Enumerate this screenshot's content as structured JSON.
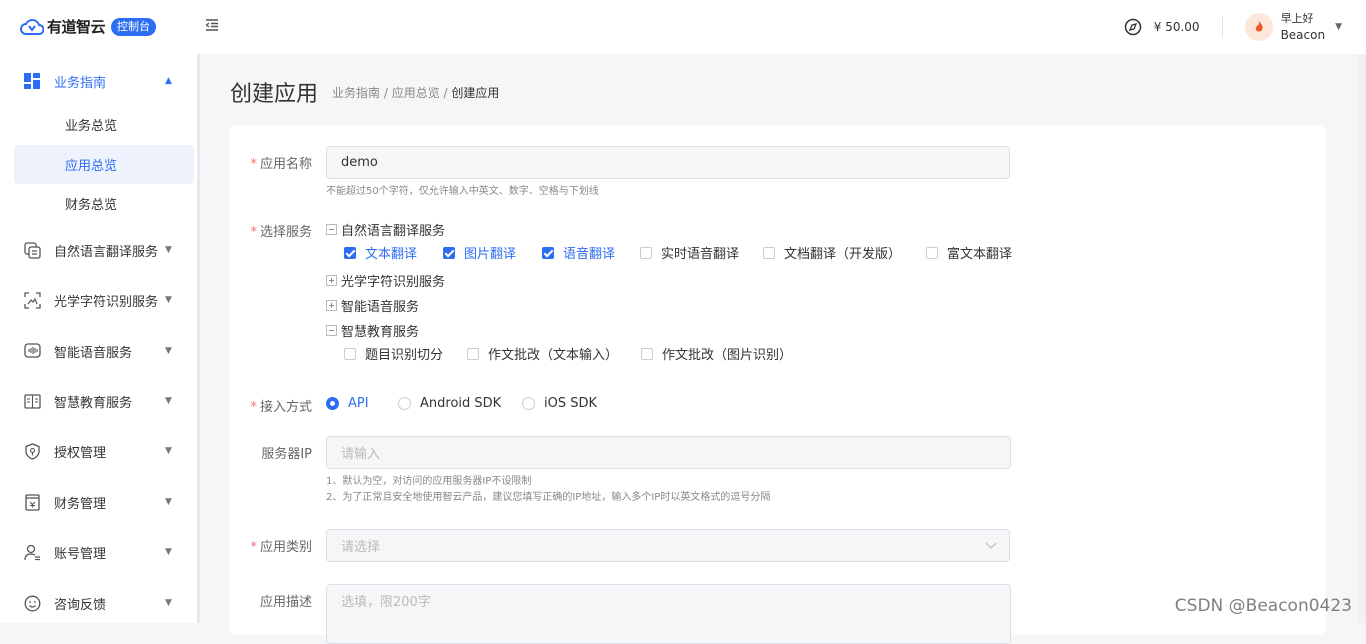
{
  "header": {
    "logo_text": "有道智云",
    "logo_badge": "控制台",
    "balance": "¥ 50.00",
    "greeting": "早上好",
    "username": "Beacon"
  },
  "sidebar": {
    "group1": {
      "label": "业务指南",
      "items": [
        "业务总览",
        "应用总览",
        "财务总览"
      ]
    },
    "menus": [
      "自然语言翻译服务",
      "光学字符识别服务",
      "智能语音服务",
      "智慧教育服务",
      "授权管理",
      "财务管理",
      "账号管理",
      "咨询反馈"
    ]
  },
  "page": {
    "title": "创建应用",
    "breadcrumb": [
      "业务指南",
      "应用总览",
      "创建应用"
    ],
    "sep": " / "
  },
  "form": {
    "name_label": "应用名称",
    "name_value": "demo",
    "name_hint": "不能超过50个字符，仅允许输入中英文、数字、空格与下划线",
    "service_label": "选择服务",
    "services": {
      "nlp": {
        "label": "自然语言翻译服务",
        "options": [
          {
            "label": "文本翻译",
            "checked": true
          },
          {
            "label": "图片翻译",
            "checked": true
          },
          {
            "label": "语音翻译",
            "checked": true
          },
          {
            "label": "实时语音翻译",
            "checked": false
          },
          {
            "label": "文档翻译（开发版）",
            "checked": false
          },
          {
            "label": "富文本翻译",
            "checked": false
          }
        ]
      },
      "ocr": {
        "label": "光学字符识别服务"
      },
      "voice": {
        "label": "智能语音服务"
      },
      "edu": {
        "label": "智慧教育服务",
        "options": [
          {
            "label": "题目识别切分",
            "checked": false
          },
          {
            "label": "作文批改（文本输入）",
            "checked": false
          },
          {
            "label": "作文批改（图片识别）",
            "checked": false
          }
        ]
      }
    },
    "access_label": "接入方式",
    "access_options": [
      {
        "label": "API",
        "selected": true
      },
      {
        "label": "Android SDK",
        "selected": false
      },
      {
        "label": "iOS SDK",
        "selected": false
      }
    ],
    "ip_label": "服务器IP",
    "ip_placeholder": "请输入",
    "ip_hint1": "1、默认为空，对访问的应用服务器IP不设限制",
    "ip_hint2": "2、为了正常且安全地使用智云产品，建议您填写正确的IP地址，输入多个IP时以英文格式的逗号分隔",
    "category_label": "应用类别",
    "category_placeholder": "请选择",
    "desc_label": "应用描述",
    "desc_placeholder": "选填，限200字"
  },
  "watermark": "CSDN @Beacon0423",
  "colors": {
    "accent": "#2c6df3",
    "required": "#f56c6c"
  }
}
